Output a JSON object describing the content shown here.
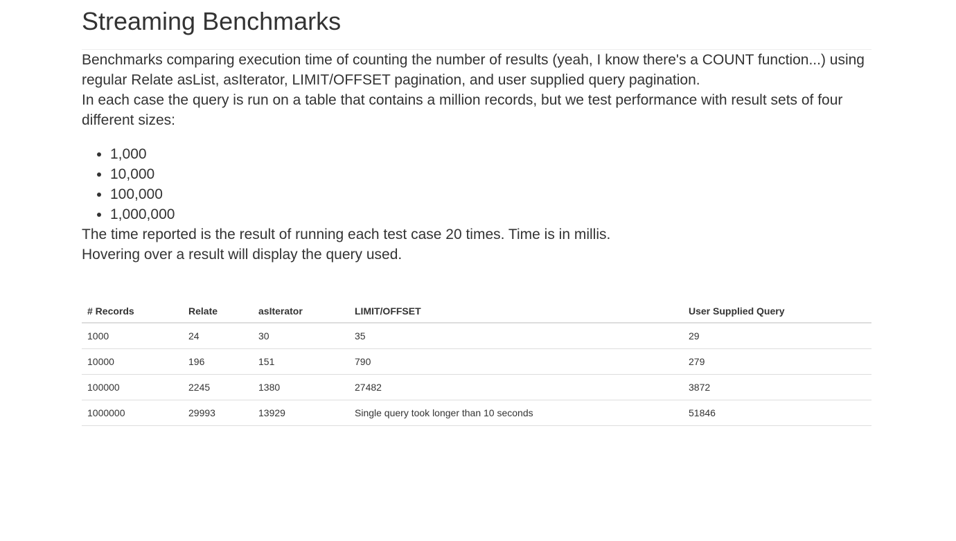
{
  "title": "Streaming Benchmarks",
  "paragraphs": {
    "intro": "Benchmarks comparing execution time of counting the number of results (yeah, I know there's a COUNT function...) using regular Relate asList, asIterator, LIMIT/OFFSET pagination, and user supplied query pagination.",
    "case": "In each case the query is run on a table that contains a million records, but we test performance with result sets of four different sizes:",
    "time": "The time reported is the result of running each test case 20 times. Time is in millis.",
    "hover": "Hovering over a result will display the query used."
  },
  "sizes": [
    "1,000",
    "10,000",
    "100,000",
    "1,000,000"
  ],
  "table": {
    "headers": [
      "# Records",
      "Relate",
      "asIterator",
      "LIMIT/OFFSET",
      "User Supplied Query"
    ],
    "rows": [
      [
        "1000",
        "24",
        "30",
        "35",
        "29"
      ],
      [
        "10000",
        "196",
        "151",
        "790",
        "279"
      ],
      [
        "100000",
        "2245",
        "1380",
        "27482",
        "3872"
      ],
      [
        "1000000",
        "29993",
        "13929",
        "Single query took longer than 10 seconds",
        "51846"
      ]
    ]
  }
}
